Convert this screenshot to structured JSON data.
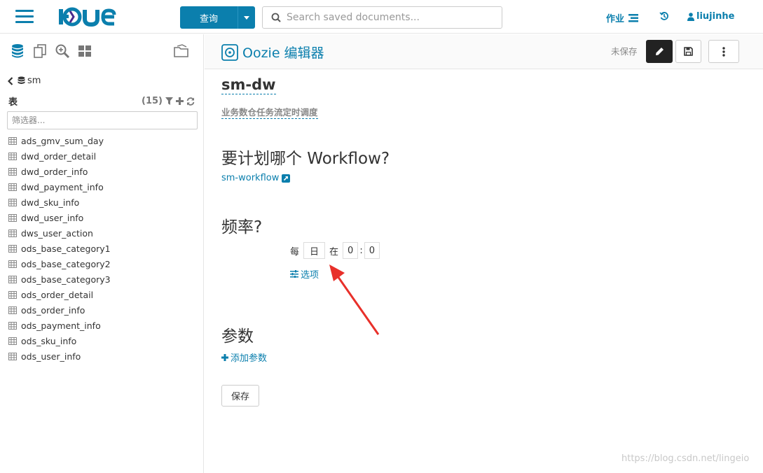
{
  "topbar": {
    "query_label": "查询",
    "search_placeholder": "Search saved documents...",
    "jobs_label": "作业",
    "user_label": "liujinhe"
  },
  "sidebar": {
    "database": "sm",
    "tables_title": "表",
    "tables_count": "(15)",
    "filter_placeholder": "筛选器...",
    "tables": [
      "ads_gmv_sum_day",
      "dwd_order_detail",
      "dwd_order_info",
      "dwd_payment_info",
      "dwd_sku_info",
      "dwd_user_info",
      "dws_user_action",
      "ods_base_category1",
      "ods_base_category2",
      "ods_base_category3",
      "ods_order_detail",
      "ods_order_info",
      "ods_payment_info",
      "ods_sku_info",
      "ods_user_info"
    ]
  },
  "header": {
    "title": "Oozie 编辑器",
    "unsaved": "未保存"
  },
  "coordinator": {
    "name": "sm-dw",
    "description": "业务数仓任务流定时调度",
    "which_workflow_heading": "要计划哪个 Workflow?",
    "workflow_link": "sm-workflow",
    "frequency_heading": "频率?",
    "every_label": "每",
    "unit_value": "日",
    "at_label": "在",
    "hour_value": "0",
    "colon": ":",
    "minute_value": "0",
    "options_label": "选项",
    "params_heading": "参数",
    "add_param_label": "添加参数",
    "save_label": "保存"
  },
  "watermark": "https://blog.csdn.net/lingeio",
  "colors": {
    "accent": "#0B7FAD",
    "arrow": "#e8302a"
  }
}
